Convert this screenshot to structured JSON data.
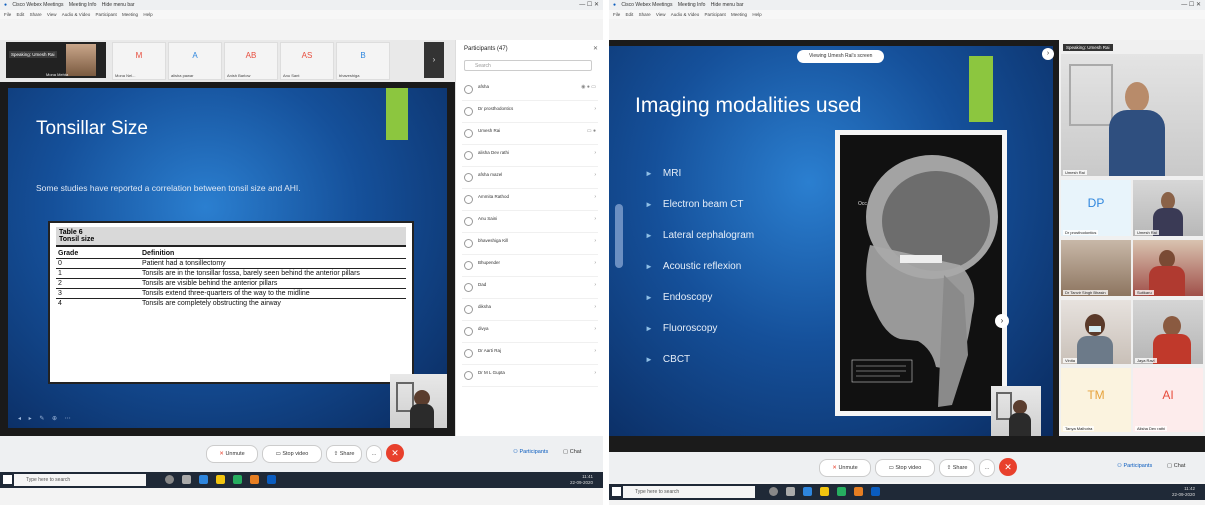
{
  "left": {
    "window_title": "Cisco Webex Meetings",
    "window_tabs": [
      "Meeting Info",
      "Hide menu bar"
    ],
    "menu": [
      "File",
      "Edit",
      "Share",
      "View",
      "Audio & Video",
      "Participant",
      "Meeting",
      "Help"
    ],
    "speaking_label": "Speaking: Umesh Rai",
    "thumbnails": [
      {
        "initials": "",
        "name": "Mona Mehta"
      },
      {
        "initials": "M",
        "name": "Mona Nel..."
      },
      {
        "initials": "A",
        "name": "alisha pawar"
      },
      {
        "initials": "AB",
        "name": "Anish Barlow"
      },
      {
        "initials": "AS",
        "name": "Anu Sant"
      },
      {
        "initials": "B",
        "name": "bhaveshiga"
      }
    ],
    "slide": {
      "title": "Tonsillar Size",
      "subtitle": "Some studies have reported a correlation between tonsil size and AHI.",
      "table_caption": "Table 6",
      "table_subcaption": "Tonsil size",
      "headers": [
        "Grade",
        "Definition"
      ],
      "rows": [
        [
          "0",
          "Patient had a tonsillectomy"
        ],
        [
          "1",
          "Tonsils are in the tonsillar fossa, barely seen behind the anterior pillars"
        ],
        [
          "2",
          "Tonsils are visible behind the anterior pillars"
        ],
        [
          "3",
          "Tonsils extend three-quarters of the way to the midline"
        ],
        [
          "4",
          "Tonsils are completely obstructing the airway"
        ]
      ]
    },
    "participants_title": "Participants (47)",
    "search_placeholder": "Search",
    "participants": [
      "afsha",
      "Dr prosthodontics",
      "Umesh Rai",
      "alisha Dev rathi",
      "afsha mazel",
      "Ammita Rathod",
      "Anu Saini",
      "bhaveshiga Kill",
      "Bhupender",
      "Dad",
      "diksha",
      "divya",
      "Dr Aarti Raj",
      "Dr M L Gupta"
    ],
    "controls": {
      "unmute": "Unmute",
      "stop_video": "Stop video",
      "share": "Share",
      "more": "...",
      "participants": "Participants",
      "chat": "Chat"
    },
    "taskbar": {
      "search": "Type here to search",
      "time": "11:41",
      "date": "22-09-2020"
    }
  },
  "right": {
    "window_title": "Cisco Webex Meetings",
    "window_tabs": [
      "Meeting Info",
      "Hide menu bar"
    ],
    "menu": [
      "File",
      "Edit",
      "Share",
      "View",
      "Audio & Video",
      "Participant",
      "Meeting",
      "Help"
    ],
    "share_banner": "Viewing Umesh Rai's screen",
    "speaking_label": "Speaking: Umesh Rai",
    "slide": {
      "title": "Imaging modalities used",
      "bullets": [
        "MRI",
        "Electron beam CT",
        "Lateral cephalogram",
        "Acoustic reflexion",
        "Endoscopy",
        "Fluoroscopy",
        "CBCT"
      ]
    },
    "video_tiles": [
      {
        "name": "Umesh Rai",
        "initials": ""
      },
      {
        "name": "Dr prosthodontics",
        "initials": "DP"
      },
      {
        "name": "Umesh Rai",
        "initials": ""
      },
      {
        "name": "Dr Tanvir Singh Bhasin",
        "initials": ""
      },
      {
        "name": "Sutikaru",
        "initials": ""
      },
      {
        "name": "Vinita",
        "initials": ""
      },
      {
        "name": "Jaya Ravi",
        "initials": ""
      },
      {
        "name": "Tanya Malhotra",
        "initials": "TM"
      },
      {
        "name": "Alisha Dev rathi",
        "initials": "AI"
      }
    ],
    "controls": {
      "unmute": "Unmute",
      "stop_video": "Stop video",
      "share": "Share",
      "more": "...",
      "participants": "Participants",
      "chat": "Chat"
    },
    "taskbar": {
      "search": "Type here to search",
      "time": "11:42",
      "date": "22-09-2020"
    }
  },
  "colors": {
    "slide_accent": "#8cc63f",
    "leave_button": "#e8402c",
    "taskbar": "#1f2937",
    "webex_blue": "#0a5cbf"
  }
}
